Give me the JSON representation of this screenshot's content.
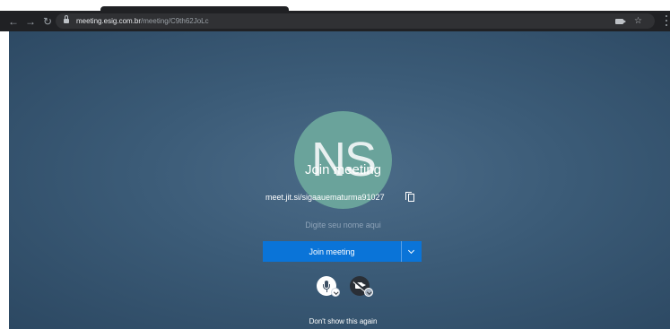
{
  "browser": {
    "url_host": "meeting.esig.com.br",
    "url_path": "/meeting/C9th62JoLc",
    "icons": [
      "back-icon",
      "forward-icon",
      "reload-icon",
      "lock-icon",
      "camera-icon",
      "star-icon",
      "menu-icon"
    ]
  },
  "prejoin": {
    "avatar_initials": "NS",
    "title": "Join meeting",
    "meeting_url": "meet.jit.si/sigaauematurma91027",
    "name_placeholder": "Digite seu nome aqui",
    "join_label": "Join meeting",
    "dont_show_label": "Don't show this again"
  },
  "colors": {
    "accent": "#0a74d8",
    "avatar": "#6aa39b",
    "background": "#3b5b77"
  }
}
